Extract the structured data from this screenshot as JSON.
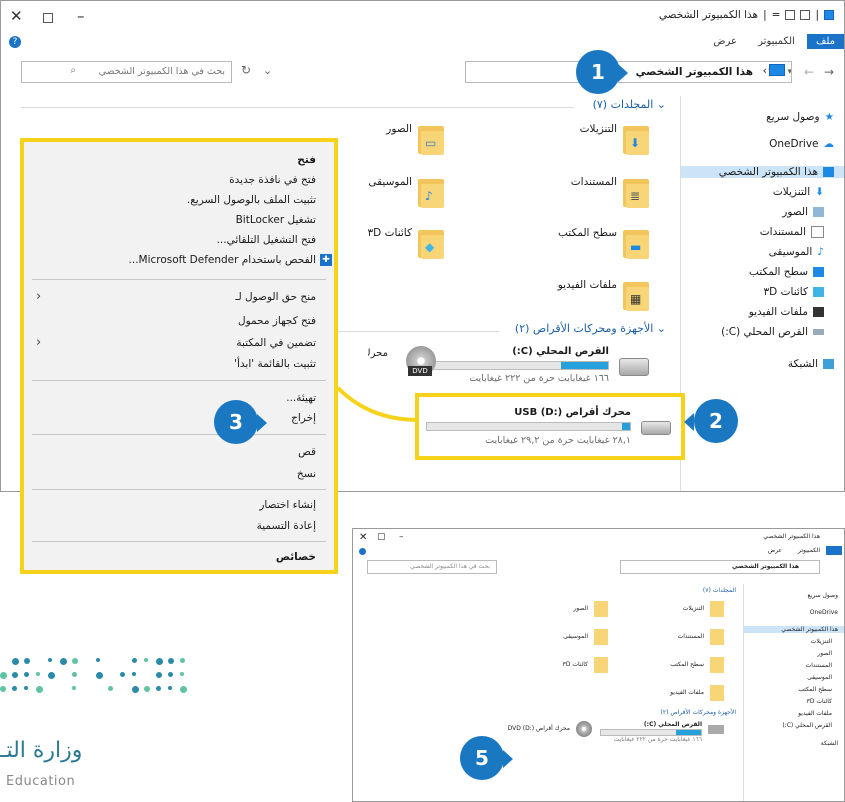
{
  "window": {
    "title": "هذا الكمبيوتر الشخصي",
    "qat_sep": "|",
    "qat_arrow": "=",
    "tabs": [
      "ملف",
      "الكمبيوتر",
      "عرض"
    ],
    "address": "هذا الكمبيوتر الشخصي",
    "address_sep": "›",
    "search_placeholder": "بحث في هذا الكمبيوتر الشخصي",
    "help_glyph": "?",
    "chevron_down": "⌄"
  },
  "nav_pane": {
    "items": [
      {
        "label": "وصول سريع",
        "icon": "star-icon"
      },
      {
        "label": "OneDrive",
        "icon": "cloud-icon"
      },
      {
        "label": "هذا الكمبيوتر الشخصي",
        "icon": "computer-icon"
      },
      {
        "label": "التنزيلات",
        "icon": "download-icon"
      },
      {
        "label": "الصور",
        "icon": "pictures-icon"
      },
      {
        "label": "المستندات",
        "icon": "documents-icon"
      },
      {
        "label": "الموسيقى",
        "icon": "music-icon"
      },
      {
        "label": "سطح المكتب",
        "icon": "desktop-icon"
      },
      {
        "label": "كائنات ۳D",
        "icon": "objects-3d-icon"
      },
      {
        "label": "ملفات الفيديو",
        "icon": "video-icon"
      },
      {
        "label": "القرص المحلي (C:)",
        "icon": "drive-icon"
      },
      {
        "label": "الشبكة",
        "icon": "network-icon"
      }
    ]
  },
  "folders_group": "المجلدات (٧)",
  "folders": [
    {
      "label": "التنزيلات",
      "glyph": "⬇"
    },
    {
      "label": "الصور",
      "glyph": "▭"
    },
    {
      "label": "المستندات",
      "glyph": "≣"
    },
    {
      "label": "الموسيقى",
      "glyph": "♪"
    },
    {
      "label": "سطح المكتب",
      "glyph": "▬"
    },
    {
      "label": "كائنات ۳D",
      "glyph": "◆"
    },
    {
      "label": "ملفات الفيديو",
      "glyph": "▦"
    }
  ],
  "drives_group": "الأجهزة ومحركات الأقراص (٢)",
  "drives": [
    {
      "name": "القرص المحلي (C:)",
      "free": "١٦٦ غيغابايت حرة من ٢٢٢ غيغابايت",
      "used_fraction": 0.25
    },
    {
      "name": "محرك أقراص USB (D:)",
      "free": "٢٨,١ غيغابايت حرة من ٢٩,٢ غيغابايت",
      "used_fraction": 0.04
    },
    {
      "name": "محرك أقراص DVD (D:)",
      "disc_label": "DVD"
    }
  ],
  "context_menu": {
    "items": [
      "فتح",
      "فتح في نافذة جديدة",
      "تثبيت الملف بالوصول السريع.",
      "تشغيل BitLocker",
      "فتح التشغيل التلقائي...",
      "الفحص باستخدام Microsoft Defender...",
      "منح حق الوصول لـ",
      "فتح كجهاز محمول",
      "تضمين في المكتبة",
      "تثبيت بالقائمة 'ابدأ'",
      "تهيئة...",
      "إخراج",
      "قص",
      "نسخ",
      "إنشاء اختصار",
      "إعادة التسمية",
      "خصائص"
    ],
    "submenu_glyph": "‹"
  },
  "badges": {
    "b1": "1",
    "b2": "2",
    "b3": "3",
    "b5": "5"
  },
  "logo": {
    "text_ar": "وزارة التـ",
    "text_en": "Education"
  },
  "colors": {
    "accent": "#1a78c2",
    "highlight": "#f6d31a",
    "selection": "#cce4f7"
  }
}
